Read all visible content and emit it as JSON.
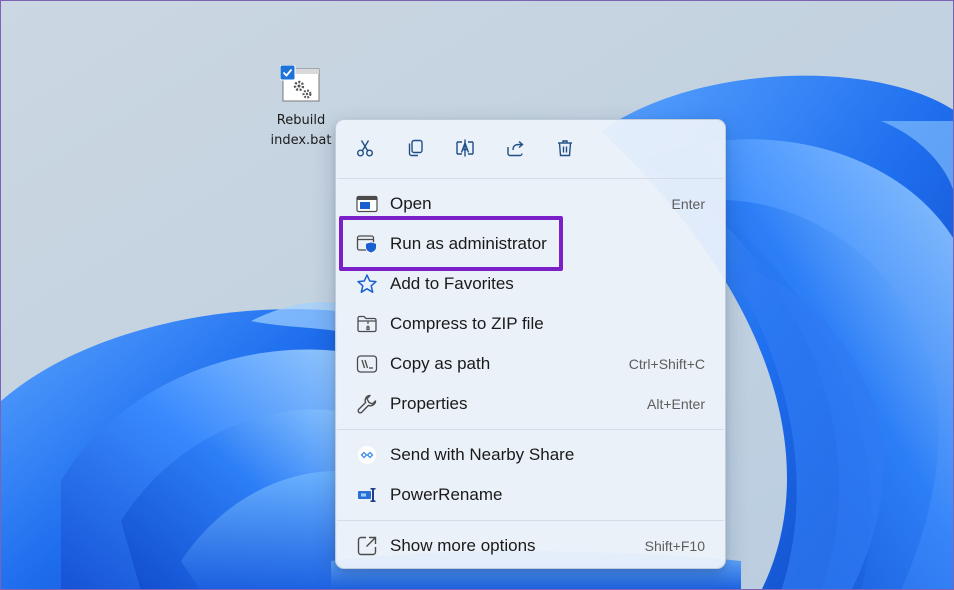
{
  "desktop": {
    "icon": {
      "label_line1": "Rebuild",
      "label_line2": "index.bat",
      "icon": "batch-file-gear-icon"
    }
  },
  "context_menu": {
    "quick_actions": [
      {
        "name": "cut",
        "icon": "scissors-icon"
      },
      {
        "name": "copy",
        "icon": "copy-icon"
      },
      {
        "name": "rename",
        "icon": "rename-icon"
      },
      {
        "name": "share",
        "icon": "share-icon"
      },
      {
        "name": "delete",
        "icon": "trash-icon"
      }
    ],
    "items": [
      {
        "label": "Open",
        "shortcut": "Enter",
        "icon": "open-window-icon"
      },
      {
        "label": "Run as administrator",
        "shortcut": "",
        "icon": "admin-shield-icon"
      },
      {
        "label": "Add to Favorites",
        "shortcut": "",
        "icon": "star-icon"
      },
      {
        "label": "Compress to ZIP file",
        "shortcut": "",
        "icon": "zip-folder-icon"
      },
      {
        "label": "Copy as path",
        "shortcut": "Ctrl+Shift+C",
        "icon": "copy-path-icon"
      },
      {
        "label": "Properties",
        "shortcut": "Alt+Enter",
        "icon": "wrench-icon"
      },
      {
        "label": "Send with Nearby Share",
        "shortcut": "",
        "icon": "nearby-share-icon"
      },
      {
        "label": "PowerRename",
        "shortcut": "",
        "icon": "powerrename-icon"
      },
      {
        "label": "Show more options",
        "shortcut": "Shift+F10",
        "icon": "show-more-icon"
      }
    ]
  },
  "colors": {
    "accent": "#0067c0",
    "highlight": "#7b1fc9",
    "wallpaper_blue": "#1a6ee8"
  }
}
